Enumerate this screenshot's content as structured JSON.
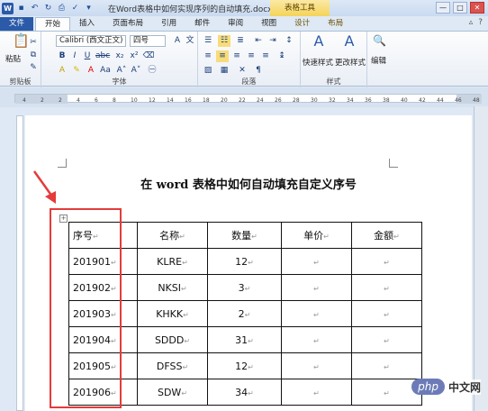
{
  "titlebar": {
    "title": "在Word表格中如何实现序列的自动填充.docx M...",
    "context_tab": "表格工具",
    "word_logo": "W",
    "win_min": "—",
    "win_max": "□",
    "win_close": "✕"
  },
  "tabs": {
    "file": "文件",
    "items": [
      "开始",
      "插入",
      "页面布局",
      "引用",
      "邮件",
      "审阅",
      "视图",
      "设计",
      "布局"
    ],
    "active_index": 0,
    "help_icon": "?"
  },
  "ribbon": {
    "clipboard": {
      "paste": "粘贴",
      "label": "剪贴板"
    },
    "font": {
      "name": "Calibri (西文正文)",
      "size": "四号",
      "label": "字体"
    },
    "paragraph": {
      "label": "段落"
    },
    "styles": {
      "quick": "快速样式",
      "change": "更改样式",
      "label": "样式"
    },
    "editing": {
      "label": "编辑"
    }
  },
  "ruler": {
    "ticks": [
      "4",
      "2",
      "2",
      "4",
      "6",
      "8",
      "10",
      "12",
      "14",
      "16",
      "18",
      "20",
      "22",
      "24",
      "26",
      "28",
      "30",
      "32",
      "34",
      "36",
      "38",
      "40",
      "42",
      "44",
      "46",
      "48"
    ]
  },
  "document": {
    "heading": "在 word 表格中如何自动填充自定义序号",
    "table": {
      "headers": [
        "序号",
        "名称",
        "数量",
        "单价",
        "金额"
      ],
      "rows": [
        [
          "201901",
          "KLRE",
          "12",
          "",
          ""
        ],
        [
          "201902",
          "NKSI",
          "3",
          "",
          ""
        ],
        [
          "201903",
          "KHKK",
          "2",
          "",
          ""
        ],
        [
          "201904",
          "SDDD",
          "31",
          "",
          ""
        ],
        [
          "201905",
          "DFSS",
          "12",
          "",
          ""
        ],
        [
          "201906",
          "SDW",
          "34",
          "",
          ""
        ]
      ]
    }
  },
  "watermark": {
    "php": "php",
    "cn": "中文网"
  },
  "colors": {
    "accent": "#2b5aa8",
    "highlight_box": "#e53b3b"
  }
}
